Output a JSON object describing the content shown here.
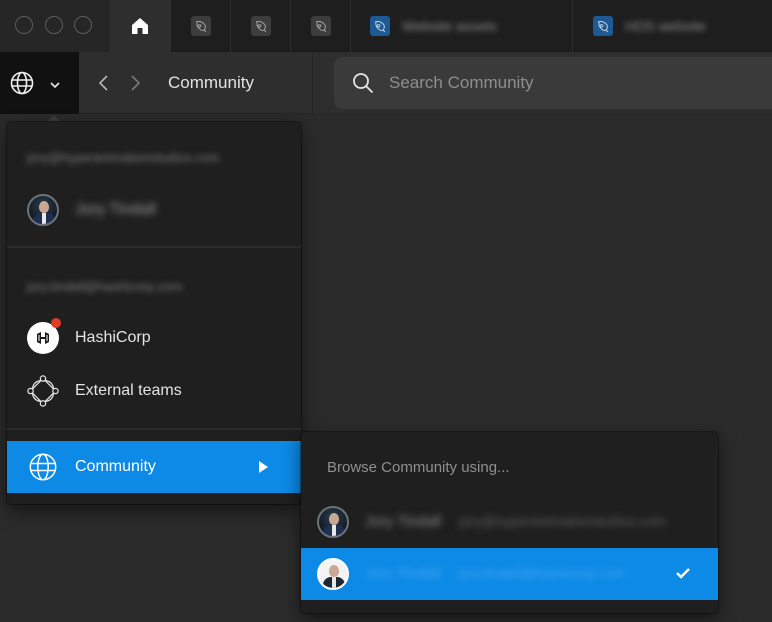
{
  "window": {
    "traffic_lights": [
      "close",
      "minimize",
      "zoom"
    ]
  },
  "tabs": [
    {
      "type": "home",
      "icon": "home-icon",
      "label": ""
    },
    {
      "type": "file",
      "icon": "figma-file-icon",
      "label": "",
      "color": "#3d3d3d"
    },
    {
      "type": "file",
      "icon": "figma-file-icon",
      "label": "",
      "color": "#3d3d3d"
    },
    {
      "type": "file",
      "icon": "figma-file-icon",
      "label": "",
      "color": "#3d3d3d"
    },
    {
      "type": "file",
      "icon": "figma-file-icon",
      "label": "Website assets",
      "color": "#1d5a94",
      "redacted": true
    },
    {
      "type": "file",
      "icon": "figma-file-icon",
      "label": "HDS website",
      "color": "#1d5a94",
      "redacted": true
    }
  ],
  "navbar": {
    "switcher_icon": "globe-icon",
    "back_icon": "chevron-left-icon",
    "forward_icon": "chevron-right-icon",
    "breadcrumb": "Community",
    "search": {
      "placeholder": "Search Community",
      "value": ""
    }
  },
  "account_menu": {
    "accounts": [
      {
        "email": "jory@hyperanimationstudios.com",
        "redacted": true,
        "user_name": "Jory Tindall",
        "user_redacted": true
      },
      {
        "email": "jory.tindall@hashicorp.com",
        "redacted": true,
        "teams": [
          {
            "label": "HashiCorp",
            "icon": "hashicorp-logo-icon",
            "notification": true
          },
          {
            "label": "External teams",
            "icon": "external-teams-icon",
            "notification": false
          }
        ]
      }
    ],
    "community_item": {
      "label": "Community",
      "icon": "globe-icon",
      "active": true
    }
  },
  "community_submenu": {
    "title": "Browse Community using...",
    "options": [
      {
        "name": "Jory Tindall",
        "email": "jory@hyperanimationstudios.com",
        "redacted": true,
        "selected": false
      },
      {
        "name": "Jory Tindall",
        "email": "jory.tindall@hashicorp.com",
        "redacted": true,
        "selected": true
      }
    ]
  },
  "colors": {
    "accent": "#0c8ae6",
    "notification": "#e03b24",
    "menu_bg": "#1f1f1f",
    "canvas_bg": "#2b2b2b"
  }
}
